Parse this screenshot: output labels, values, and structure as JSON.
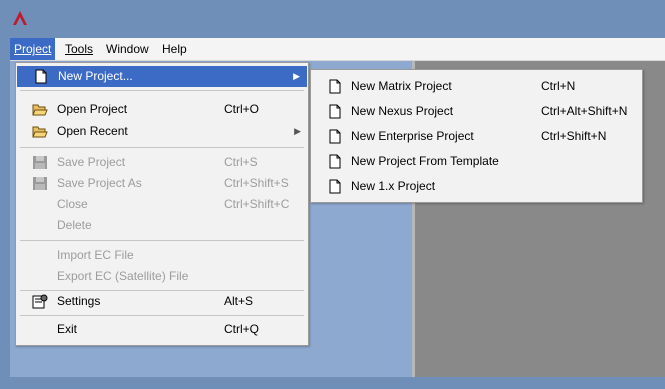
{
  "menubar": {
    "items": [
      {
        "label": "Project",
        "mnemonic": "P"
      },
      {
        "label": "Tools",
        "mnemonic": "T"
      },
      {
        "label": "Window"
      },
      {
        "label": "Help"
      }
    ]
  },
  "project_menu": {
    "new_project": {
      "label": "New Project...",
      "state": "highlighted"
    },
    "open_project": {
      "label": "Open Project",
      "shortcut": "Ctrl+O"
    },
    "open_recent": {
      "label": "Open Recent"
    },
    "save_project": {
      "label": "Save Project",
      "shortcut": "Ctrl+S",
      "enabled": false
    },
    "save_project_as": {
      "label": "Save Project As",
      "shortcut": "Ctrl+Shift+S",
      "enabled": false
    },
    "close": {
      "label": "Close",
      "shortcut": "Ctrl+Shift+C",
      "enabled": false
    },
    "delete": {
      "label": "Delete",
      "enabled": false
    },
    "import_ec": {
      "label": "Import EC File",
      "enabled": false
    },
    "export_ec": {
      "label": "Export EC (Satellite) File",
      "enabled": false
    },
    "settings": {
      "label": "Settings",
      "shortcut": "Alt+S"
    },
    "exit": {
      "label": "Exit",
      "shortcut": "Ctrl+Q"
    }
  },
  "new_submenu": {
    "items": [
      {
        "label": "New Matrix Project",
        "shortcut": "Ctrl+N"
      },
      {
        "label": "New Nexus Project",
        "shortcut": "Ctrl+Alt+Shift+N"
      },
      {
        "label": "New Enterprise Project",
        "shortcut": "Ctrl+Shift+N"
      },
      {
        "label": "New Project From Template",
        "shortcut": ""
      },
      {
        "label": "New 1.x Project",
        "shortcut": ""
      }
    ]
  },
  "colors": {
    "highlight": "#3c6bc6",
    "menu_background": "#f2f2f2",
    "disabled_text": "#9c9c9c",
    "title_bar": "#6f8fb8",
    "logo": "#c0192c"
  },
  "icons": {
    "app": "ca-logo-icon",
    "new_project": "document-icon",
    "open_project": "open-folder-icon",
    "open_recent": "open-folder-icon",
    "save": "floppy-disk-icon",
    "settings": "settings-icon",
    "submenu": "document-icon"
  }
}
